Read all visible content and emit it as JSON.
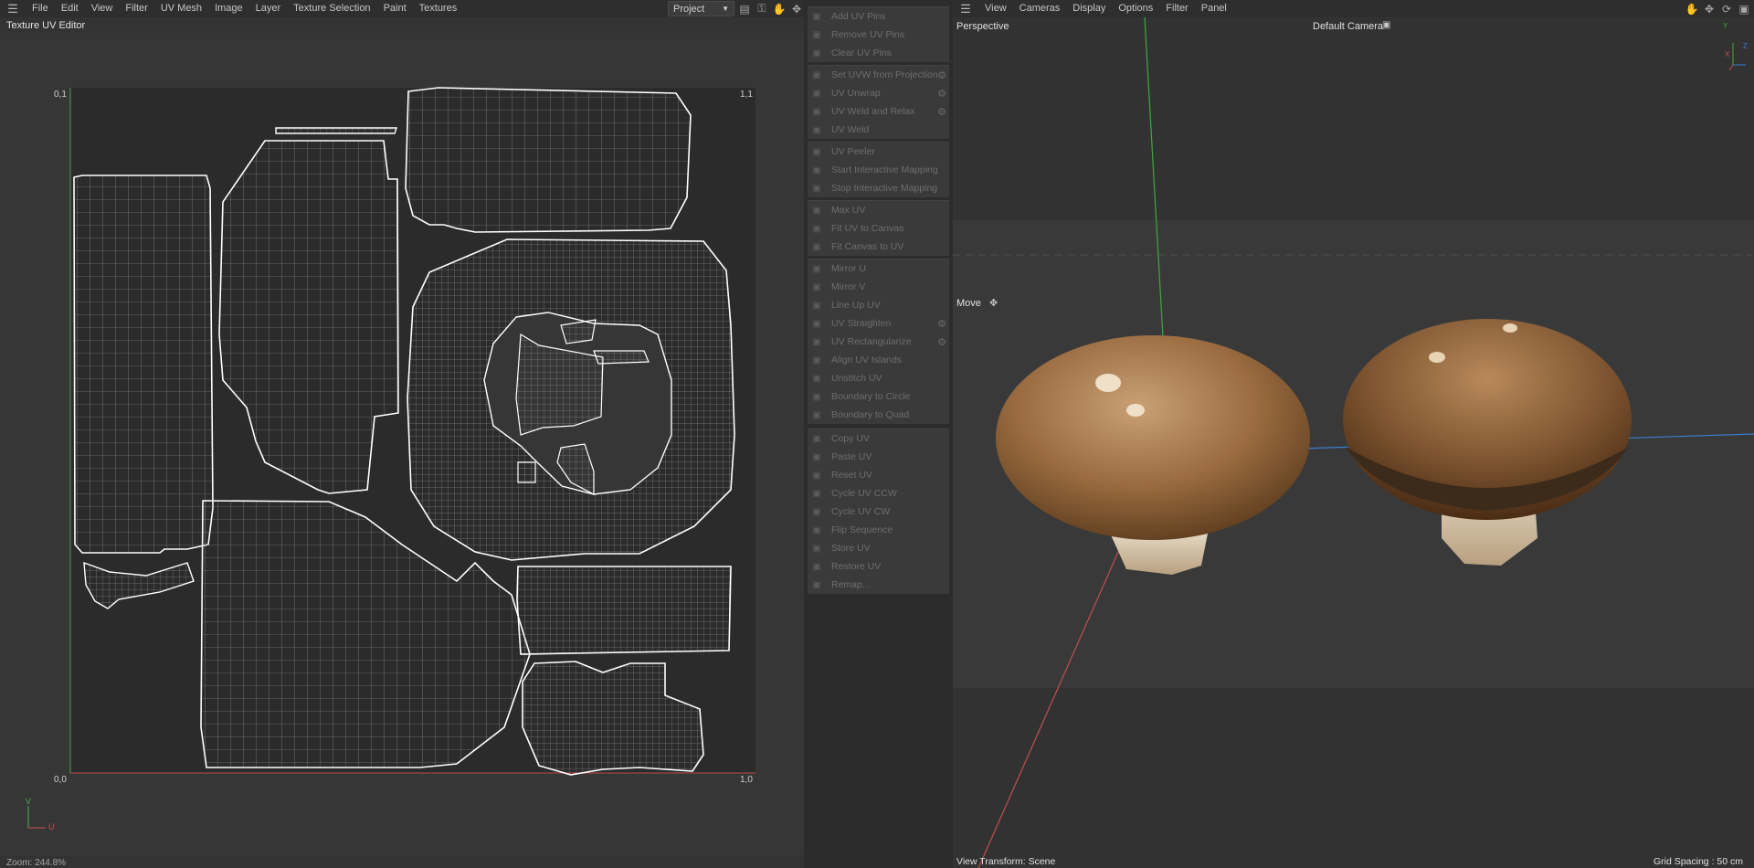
{
  "uv_editor": {
    "menu": [
      "File",
      "Edit",
      "View",
      "Filter",
      "UV Mesh",
      "Image",
      "Layer",
      "Texture Selection",
      "Paint",
      "Textures"
    ],
    "project_select": "Project",
    "title": "Texture UV Editor",
    "corner_labels": {
      "top_left": "0,1",
      "top_right": "1,1",
      "bottom_left": "0,0",
      "bottom_right": "1,0"
    },
    "axis_labels": {
      "v": "V",
      "u": "U"
    },
    "zoom": "Zoom: 244.8%"
  },
  "uv_commands": {
    "groups": [
      [
        {
          "label": "Add UV Pins",
          "icon": "pin-add-icon"
        },
        {
          "label": "Remove UV Pins",
          "icon": "pin-remove-icon"
        },
        {
          "label": "Clear UV Pins",
          "icon": "pin-clear-icon"
        }
      ],
      [
        {
          "label": "Set UVW from Projection",
          "icon": "projection-icon",
          "gear": true
        },
        {
          "label": "UV Unwrap",
          "icon": "unwrap-icon",
          "gear": true
        },
        {
          "label": "UV Weld and Relax",
          "icon": "weld-relax-icon",
          "gear": true
        },
        {
          "label": "UV Weld",
          "icon": "weld-icon"
        }
      ],
      [
        {
          "label": "UV Peeler",
          "icon": "peeler-icon"
        },
        {
          "label": "Start Interactive Mapping",
          "icon": "play-icon"
        },
        {
          "label": "Stop Interactive Mapping",
          "icon": "stop-icon"
        }
      ],
      [
        {
          "label": "Max UV",
          "icon": "max-uv-icon"
        },
        {
          "label": "Fit UV to Canvas",
          "icon": "fit-uv-icon"
        },
        {
          "label": "Fit Canvas to UV",
          "icon": "fit-canvas-icon"
        }
      ],
      [
        {
          "label": "Mirror U",
          "icon": "mirror-u-icon"
        },
        {
          "label": "Mirror V",
          "icon": "mirror-v-icon"
        },
        {
          "label": "Line Up UV",
          "icon": "line-up-icon"
        },
        {
          "label": "UV Straighten",
          "icon": "straighten-icon",
          "gear": true
        },
        {
          "label": "UV Rectangularize",
          "icon": "rectangularize-icon",
          "gear": true
        },
        {
          "label": "Align UV Islands",
          "icon": "align-icon"
        },
        {
          "label": "Unstitch UV",
          "icon": "unstitch-icon"
        },
        {
          "label": "Boundary to Circle",
          "icon": "circle-icon"
        },
        {
          "label": "Boundary to Quad",
          "icon": "quad-icon"
        }
      ],
      [
        {
          "label": "Copy UV",
          "icon": "copy-icon"
        },
        {
          "label": "Paste UV",
          "icon": "paste-icon"
        },
        {
          "label": "Reset UV",
          "icon": "reset-icon"
        },
        {
          "label": "Cycle UV CCW",
          "icon": "cycle-ccw-icon"
        },
        {
          "label": "Cycle UV CW",
          "icon": "cycle-cw-icon"
        },
        {
          "label": "Flip Sequence",
          "icon": "flip-icon"
        },
        {
          "label": "Store UV",
          "icon": "store-icon"
        },
        {
          "label": "Restore UV",
          "icon": "restore-icon"
        },
        {
          "label": "Remap...",
          "icon": "remap-icon"
        }
      ]
    ]
  },
  "viewport": {
    "menu": [
      "View",
      "Cameras",
      "Display",
      "Options",
      "Filter",
      "Panel"
    ],
    "projection": "Perspective",
    "camera": "Default Camera",
    "tool": "Move",
    "view_transform": "View Transform: Scene",
    "grid_spacing": "Grid Spacing : 50 cm",
    "gizmo": {
      "y": "Y",
      "z": "Z",
      "x": "X"
    }
  },
  "colors": {
    "accent_axis_u": "#d05050",
    "accent_axis_v": "#50b050",
    "axis_z": "#3a7fd0"
  }
}
